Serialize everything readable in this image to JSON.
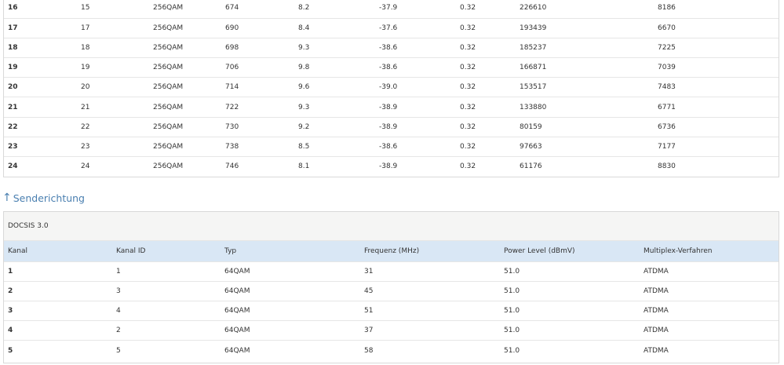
{
  "downstream": {
    "rows": [
      [
        "16",
        "15",
        "256QAM",
        "674",
        "8.2",
        "-37.9",
        "0.32",
        "226610",
        "8186"
      ],
      [
        "17",
        "17",
        "256QAM",
        "690",
        "8.4",
        "-37.6",
        "0.32",
        "193439",
        "6670"
      ],
      [
        "18",
        "18",
        "256QAM",
        "698",
        "9.3",
        "-38.6",
        "0.32",
        "185237",
        "7225"
      ],
      [
        "19",
        "19",
        "256QAM",
        "706",
        "9.8",
        "-38.6",
        "0.32",
        "166871",
        "7039"
      ],
      [
        "20",
        "20",
        "256QAM",
        "714",
        "9.6",
        "-39.0",
        "0.32",
        "153517",
        "7483"
      ],
      [
        "21",
        "21",
        "256QAM",
        "722",
        "9.3",
        "-38.9",
        "0.32",
        "133880",
        "6771"
      ],
      [
        "22",
        "22",
        "256QAM",
        "730",
        "9.2",
        "-38.9",
        "0.32",
        "80159",
        "6736"
      ],
      [
        "23",
        "23",
        "256QAM",
        "738",
        "8.5",
        "-38.6",
        "0.32",
        "97663",
        "7177"
      ],
      [
        "24",
        "24",
        "256QAM",
        "746",
        "8.1",
        "-38.9",
        "0.32",
        "61176",
        "8830"
      ]
    ]
  },
  "upstream": {
    "heading": "Senderichtung",
    "arrow_icon": "up-arrow-icon",
    "section_title": "DOCSIS 3.0",
    "headers": [
      "Kanal",
      "Kanal ID",
      "Typ",
      "Frequenz (MHz)",
      "Power Level (dBmV)",
      "Multiplex-Verfahren"
    ],
    "rows": [
      [
        "1",
        "1",
        "64QAM",
        "31",
        "51.0",
        "ATDMA"
      ],
      [
        "2",
        "3",
        "64QAM",
        "45",
        "51.0",
        "ATDMA"
      ],
      [
        "3",
        "4",
        "64QAM",
        "51",
        "51.0",
        "ATDMA"
      ],
      [
        "4",
        "2",
        "64QAM",
        "37",
        "51.0",
        "ATDMA"
      ],
      [
        "5",
        "5",
        "64QAM",
        "58",
        "51.0",
        "ATDMA"
      ]
    ]
  },
  "colors": {
    "heading": "#4a7fb0",
    "header_row_bg": "#d9e7f5",
    "section_bg": "#f5f5f4",
    "border": "#d9d9d9"
  }
}
